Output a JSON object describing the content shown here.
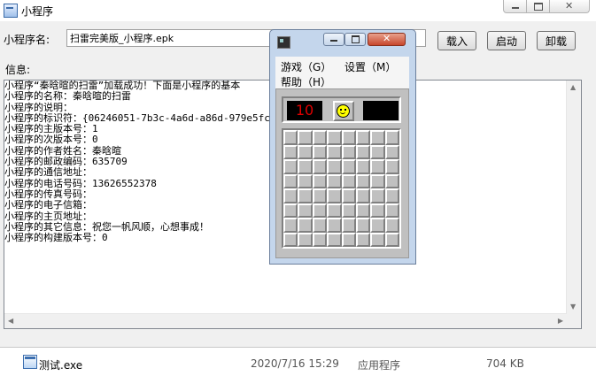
{
  "window": {
    "title": "小程序"
  },
  "form": {
    "name_label": "小程序名:",
    "name_value": "扫雷完美版_小程序.epk",
    "load_button": "载入",
    "start_button": "启动",
    "unload_button": "卸载",
    "info_label": "信息:"
  },
  "info_lines": [
    "小程序“秦晗暄的扫雷”加载成功！下面是小程序的基本",
    "小程序的名称：秦晗暄的扫雷",
    "小程序的说明：",
    "小程序的标识符：{06246051-7b3c-4a6d-a86d-979e5fcc2",
    "小程序的主版本号：1",
    "小程序的次版本号：0",
    "小程序的作者姓名：秦晗暄",
    "小程序的邮政编码：635709",
    "小程序的通信地址：",
    "小程序的电话号码：13626552378",
    "小程序的传真号码：",
    "小程序的电子信箱：",
    "小程序的主页地址：",
    "小程序的其它信息：祝您一帆风顺，心想事成！",
    "小程序的构建版本号：0"
  ],
  "minesweeper": {
    "menu": {
      "game": "游戏（G）",
      "settings": "设置（M）",
      "help": "帮助（H）"
    },
    "mine_counter": "10",
    "timer": "",
    "grid": {
      "rows": 8,
      "cols": 8
    }
  },
  "file_row": {
    "name": "测试.exe",
    "date": "2020/7/16 15:29",
    "type": "应用程序",
    "size": "704 KB"
  },
  "icons": {
    "app": "app-window-icon",
    "minesweeper": "minesweeper-icon",
    "file": "exe-file-icon"
  },
  "colors": {
    "accent": "#3a6aa8",
    "counter_digits": "#e00000",
    "face": "#ffff00",
    "close_button": "#c7472c"
  }
}
